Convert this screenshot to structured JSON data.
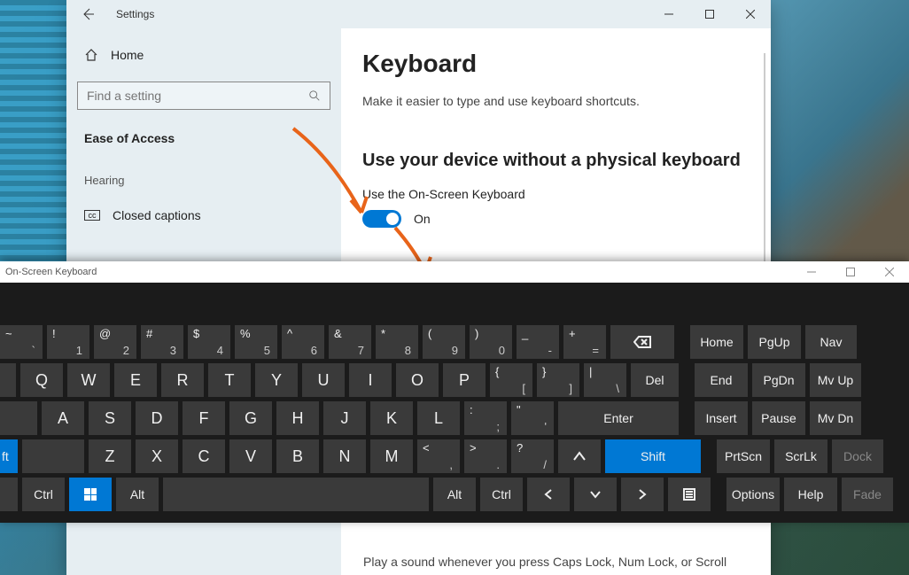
{
  "settings": {
    "titlebar": {
      "title": "Settings"
    },
    "sidebar": {
      "home": "Home",
      "search_placeholder": "Find a setting",
      "category": "Ease of Access",
      "section": "Hearing",
      "items": [
        {
          "icon": "cc",
          "label": "Closed captions"
        }
      ]
    },
    "content": {
      "page_title": "Keyboard",
      "subtitle": "Make it easier to type and use keyboard shortcuts.",
      "section_title": "Use your device without a physical keyboard",
      "toggle_label": "Use the On-Screen Keyboard",
      "toggle_state": "On",
      "peek_line": "Play a sound whenever you press Caps Lock, Num Lock, or Scroll"
    }
  },
  "osk": {
    "title": "On-Screen Keyboard",
    "rows": {
      "r1": [
        {
          "u": "~",
          "l": "`"
        },
        {
          "u": "!",
          "l": "1"
        },
        {
          "u": "@",
          "l": "2"
        },
        {
          "u": "#",
          "l": "3"
        },
        {
          "u": "$",
          "l": "4"
        },
        {
          "u": "%",
          "l": "5"
        },
        {
          "u": "^",
          "l": "6"
        },
        {
          "u": "&",
          "l": "7"
        },
        {
          "u": "*",
          "l": "8"
        },
        {
          "u": "(",
          "l": "9"
        },
        {
          "u": ")",
          "l": "0"
        },
        {
          "u": "_",
          "l": "-"
        },
        {
          "u": "+",
          "l": "="
        }
      ],
      "r2": [
        "Q",
        "W",
        "E",
        "R",
        "T",
        "Y",
        "U",
        "I",
        "O",
        "P"
      ],
      "r2b": [
        {
          "u": "{",
          "l": "["
        },
        {
          "u": "}",
          "l": "]"
        },
        {
          "u": "|",
          "l": "\\"
        }
      ],
      "r3": [
        "A",
        "S",
        "D",
        "F",
        "G",
        "H",
        "J",
        "K",
        "L"
      ],
      "r3b": [
        {
          "u": ":",
          "l": ";"
        },
        {
          "u": "\"",
          "l": "'"
        }
      ],
      "r4": [
        "Z",
        "X",
        "C",
        "V",
        "B",
        "N",
        "M"
      ],
      "r4b": [
        {
          "u": "<",
          "l": ","
        },
        {
          "u": ">",
          "l": "."
        },
        {
          "u": "?",
          "l": "/"
        }
      ],
      "r5": {
        "ctrl": "Ctrl",
        "alt": "Alt",
        "altgr": "Alt",
        "ctrl2": "Ctrl"
      },
      "special": {
        "bksp": "⌫",
        "del": "Del",
        "enter": "Enter",
        "shift": "Shift",
        "home": "Home",
        "end": "End",
        "insert": "Insert",
        "prtscn": "PrtScn",
        "pgup": "PgUp",
        "pgdn": "PgDn",
        "pause": "Pause",
        "scrlk": "ScrLk",
        "nav": "Nav",
        "mvup": "Mv Up",
        "mvdn": "Mv Dn",
        "dock": "Dock",
        "options": "Options",
        "help": "Help",
        "fade": "Fade",
        "up": "↑"
      }
    }
  }
}
